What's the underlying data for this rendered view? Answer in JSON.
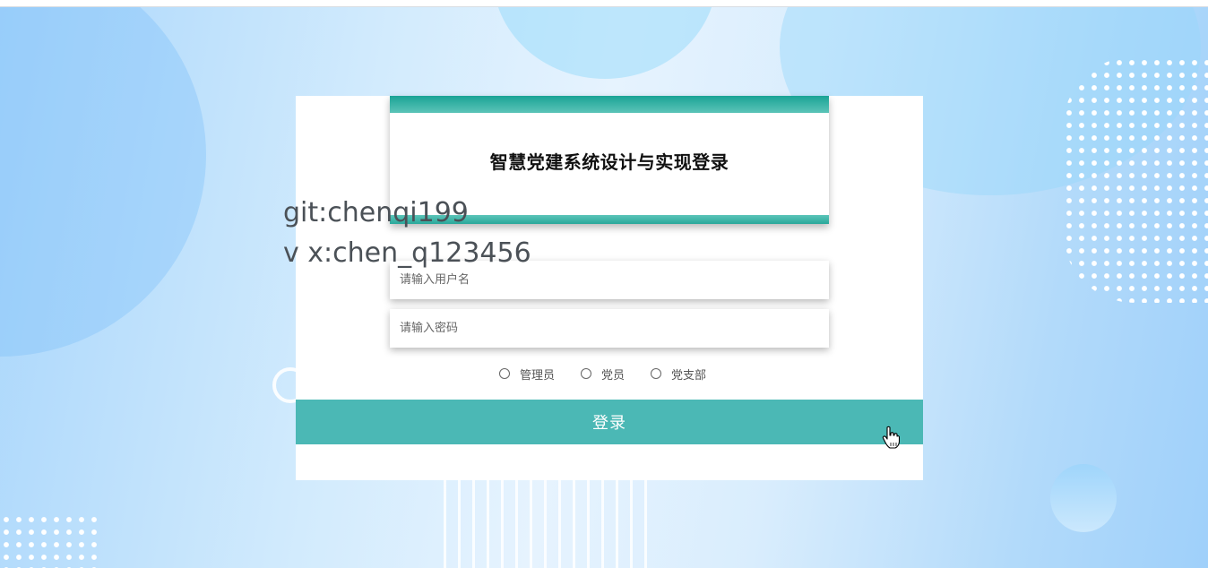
{
  "login": {
    "title": "智慧党建系统设计与实现登录",
    "username_placeholder": "请输入用户名",
    "password_placeholder": "请输入密码",
    "roles": [
      "管理员",
      "党员",
      "党支部"
    ],
    "submit_label": "登录"
  },
  "watermark": {
    "line1": "git:chenqi199",
    "line2": "v x:chen_q123456"
  },
  "colors": {
    "accent": "#4bb8b5",
    "title_bar": "#1aa395",
    "background": "#d2ebfd"
  },
  "icons": [
    "radio-circle",
    "hand-pointer-cursor"
  ]
}
